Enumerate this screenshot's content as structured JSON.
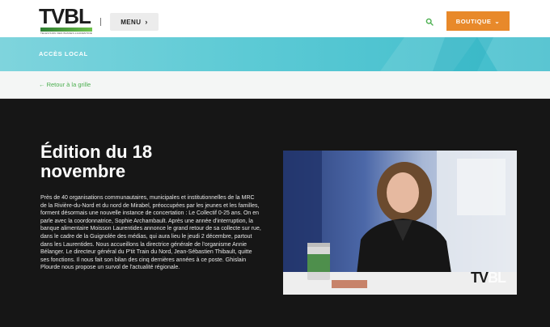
{
  "header": {
    "logo_text": "TVBL",
    "logo_tagline": "TÉLÉVISION DES BASSES-LAURENTIDES · L'IMAGE DE NOTRE RÉGION",
    "menu_label": "MENU",
    "menu_chevron": "›",
    "shop_label": "BOUTIQUE",
    "shop_chevron": "⌄",
    "search_icon": "search-icon"
  },
  "band": {
    "title": "ACCÈS LOCAL"
  },
  "nav": {
    "back_label": "← Retour à la grille"
  },
  "episode": {
    "title": "Édition du 18 novembre",
    "description": "Près de 40 organisations communautaires, municipales et institutionnelles de la MRC de la Rivière-du-Nord et du nord de Mirabel, préoccupées par les jeunes et les familles, forment désormais une nouvelle instance de concertation : Le Collectif 0-25 ans. On en parle avec la coordonnatrice, Sophie Archambault. Après une année d'interruption, la banque alimentaire Moisson Laurentides annonce le grand retour de sa collecte sur rue, dans le cadre de la Guignolée des médias, qui aura lieu le jeudi 2 décembre, partout dans les Laurentides. Nous accueillons la directrice générale de l'organisme Annie Bélanger. Le directeur général du P'tit Train du Nord, Jean-Sébastien Thibault, quitte ses fonctions. Il nous fait son bilan des cinq dernières années à ce poste. Ghislain Plourde nous propose un survol de l'actualité régionale."
  },
  "video": {
    "watermark_main": "TV",
    "watermark_tail": "BL"
  },
  "colors": {
    "accent_orange": "#e8892a",
    "teal": "#4cc3d0",
    "green_link": "#4caf50",
    "dark_bg": "#161616"
  }
}
